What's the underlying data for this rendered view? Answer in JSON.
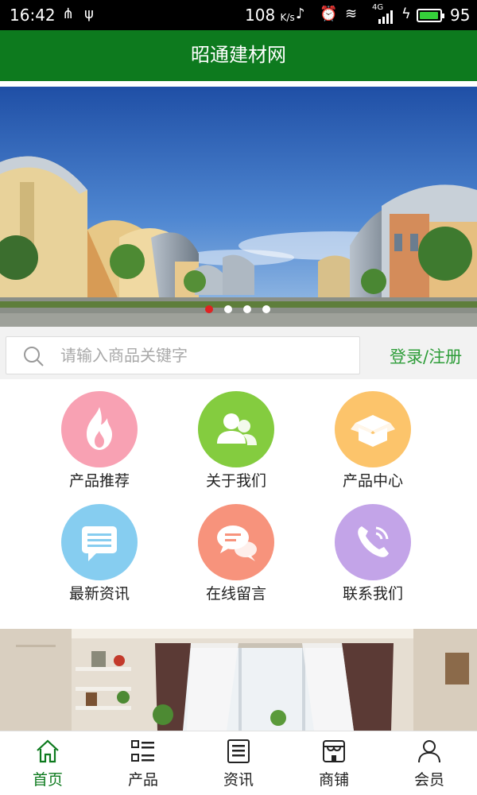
{
  "status_bar": {
    "time": "16:42",
    "network_speed": "108",
    "speed_unit": "K/s",
    "signal_label": "4G",
    "battery_percent": "95",
    "battery_level": 0.95
  },
  "header": {
    "title": "昭通建材网"
  },
  "banner": {
    "slide_count": 4,
    "active_slide": 0
  },
  "search": {
    "placeholder": "请输入商品关键字",
    "value": ""
  },
  "login_link": "登录/注册",
  "menu": [
    {
      "label": "产品推荐",
      "icon": "fire-icon",
      "color": "#f8a1b3"
    },
    {
      "label": "关于我们",
      "icon": "users-icon",
      "color": "#84cc3f"
    },
    {
      "label": "产品中心",
      "icon": "box-icon",
      "color": "#fcc46b"
    },
    {
      "label": "最新资讯",
      "icon": "message-icon",
      "color": "#86cdf0"
    },
    {
      "label": "在线留言",
      "icon": "chat-icon",
      "color": "#f7937c"
    },
    {
      "label": "联系我们",
      "icon": "phone-icon",
      "color": "#c3a4e8"
    }
  ],
  "tabs": [
    {
      "label": "首页",
      "icon": "home-icon",
      "active": true
    },
    {
      "label": "产品",
      "icon": "list-icon",
      "active": false
    },
    {
      "label": "资讯",
      "icon": "news-icon",
      "active": false
    },
    {
      "label": "商铺",
      "icon": "shop-icon",
      "active": false
    },
    {
      "label": "会员",
      "icon": "user-icon",
      "active": false
    }
  ],
  "colors": {
    "brand_green": "#0d7a1e",
    "link_green": "#2e9d39"
  }
}
